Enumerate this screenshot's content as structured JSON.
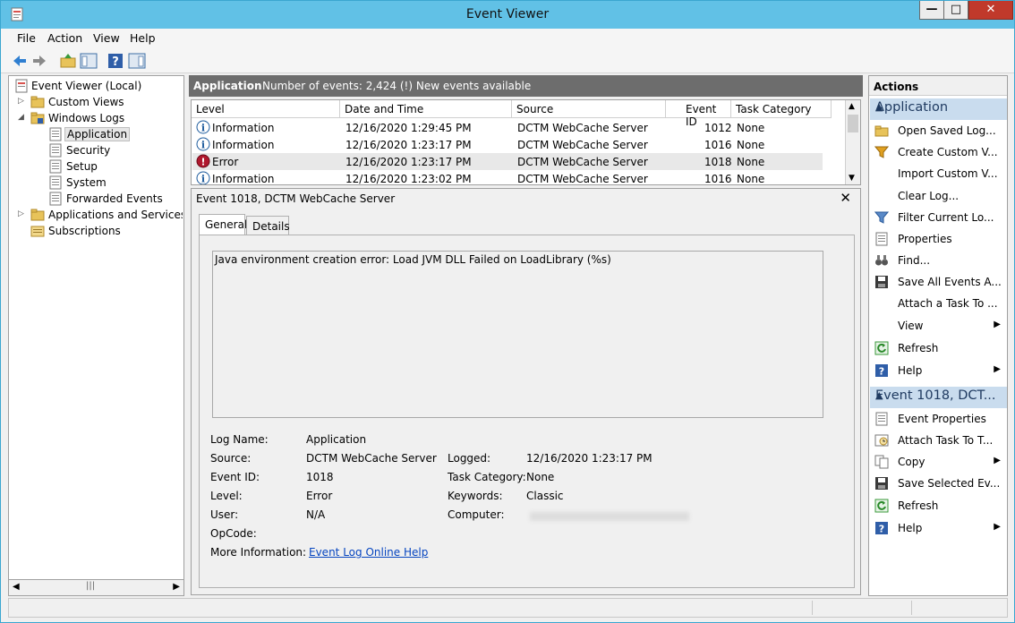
{
  "window": {
    "title": "Event Viewer"
  },
  "menu": [
    "File",
    "Action",
    "View",
    "Help"
  ],
  "tree": {
    "root": "Event Viewer (Local)",
    "custom_views": "Custom Views",
    "windows_logs": "Windows Logs",
    "application": "Application",
    "security": "Security",
    "setup": "Setup",
    "system": "System",
    "forwarded_events": "Forwarded Events",
    "apps_services": "Applications and Services Lo",
    "subscriptions": "Subscriptions"
  },
  "header": {
    "log_name": "Application",
    "info": "Number of events: 2,424 (!) New events available"
  },
  "grid": {
    "columns": [
      "Level",
      "Date and Time",
      "Source",
      "Event ID",
      "Task Category"
    ],
    "rows": [
      {
        "level": "Information",
        "date": "12/16/2020 1:29:45 PM",
        "source": "DCTM WebCache Server",
        "id": "1012",
        "task": "None"
      },
      {
        "level": "Information",
        "date": "12/16/2020 1:23:17 PM",
        "source": "DCTM WebCache Server",
        "id": "1016",
        "task": "None"
      },
      {
        "level": "Error",
        "date": "12/16/2020 1:23:17 PM",
        "source": "DCTM WebCache Server",
        "id": "1018",
        "task": "None"
      },
      {
        "level": "Information",
        "date": "12/16/2020 1:23:02 PM",
        "source": "DCTM WebCache Server",
        "id": "1016",
        "task": "None"
      }
    ]
  },
  "detail": {
    "title": "Event 1018, DCTM WebCache Server",
    "tabs": [
      "General",
      "Details"
    ],
    "message": "Java environment creation error: Load JVM DLL Failed on LoadLibrary (%s)",
    "labels": {
      "log_name": "Log Name:",
      "source": "Source:",
      "event_id": "Event ID:",
      "level": "Level:",
      "user": "User:",
      "opcode": "OpCode:",
      "more_info": "More Information:",
      "logged": "Logged:",
      "task_category": "Task Category:",
      "keywords": "Keywords:",
      "computer": "Computer:"
    },
    "values": {
      "log_name": "Application",
      "source": "DCTM WebCache Server",
      "event_id": "1018",
      "level": "Error",
      "user": "N/A",
      "opcode": "",
      "more_info_link": "Event Log Online Help",
      "logged": "12/16/2020 1:23:17 PM",
      "task_category": "None",
      "keywords": "Classic"
    }
  },
  "actions": {
    "header": "Actions",
    "section1": "Application",
    "section1_items": [
      "Open Saved Log...",
      "Create Custom V...",
      "Import Custom V...",
      "Clear Log...",
      "Filter Current Lo...",
      "Properties",
      "Find...",
      "Save All Events A...",
      "Attach a Task To ...",
      "View",
      "Refresh",
      "Help"
    ],
    "section2": "Event 1018, DCT...",
    "section2_items": [
      "Event Properties",
      "Attach Task To T...",
      "Copy",
      "Save Selected Ev...",
      "Refresh",
      "Help"
    ]
  }
}
